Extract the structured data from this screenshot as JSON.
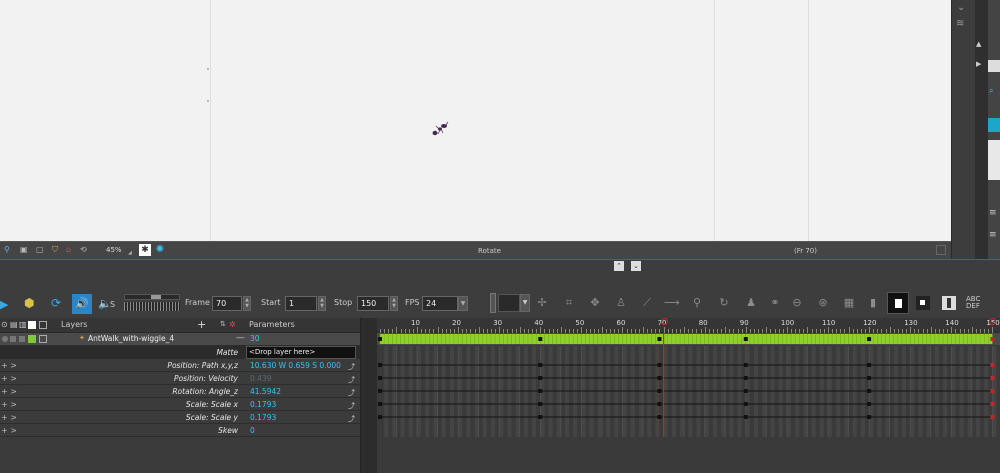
{
  "camera_bar": {
    "zoom": "45%",
    "mode": "Rotate",
    "frame_indicator": "(Fr 70)"
  },
  "toolbar": {
    "frame_label": "Frame",
    "frame_value": "70",
    "start_label": "Start",
    "start_value": "1",
    "stop_label": "Stop",
    "stop_value": "150",
    "fps_label": "FPS",
    "fps_value": "24",
    "s_label": "S"
  },
  "header": {
    "layers_label": "Layers",
    "parameters_label": "Parameters"
  },
  "layer": {
    "name": "AntWalk_with-wiggle_4",
    "value": "30"
  },
  "params": [
    {
      "label": "Matte",
      "value": "<Drop layer here>"
    },
    {
      "label": "Position: Path x,y,z",
      "value": "10.630 W  0.659 S  0.000"
    },
    {
      "label": "Position: Velocity",
      "value": "0.439"
    },
    {
      "label": "Rotation: Angle_z",
      "value": "41.5942"
    },
    {
      "label": "Scale: Scale x",
      "value": "0.1793"
    },
    {
      "label": "Scale: Scale y",
      "value": "0.1793"
    },
    {
      "label": "Skew",
      "value": "0"
    }
  ],
  "ruler": [
    "10",
    "20",
    "30",
    "40",
    "50",
    "60",
    "70",
    "80",
    "90",
    "100",
    "110",
    "120",
    "130",
    "140",
    "150"
  ],
  "timeline": {
    "current_frame": 70,
    "start": 1,
    "stop": 150,
    "keyframes": [
      1,
      40,
      69,
      90,
      120,
      150
    ]
  },
  "colors": {
    "accent": "#38c3f0",
    "track_green": "#8fd12a",
    "playhead": "#c02828",
    "layer_color": "#7ec83a"
  }
}
